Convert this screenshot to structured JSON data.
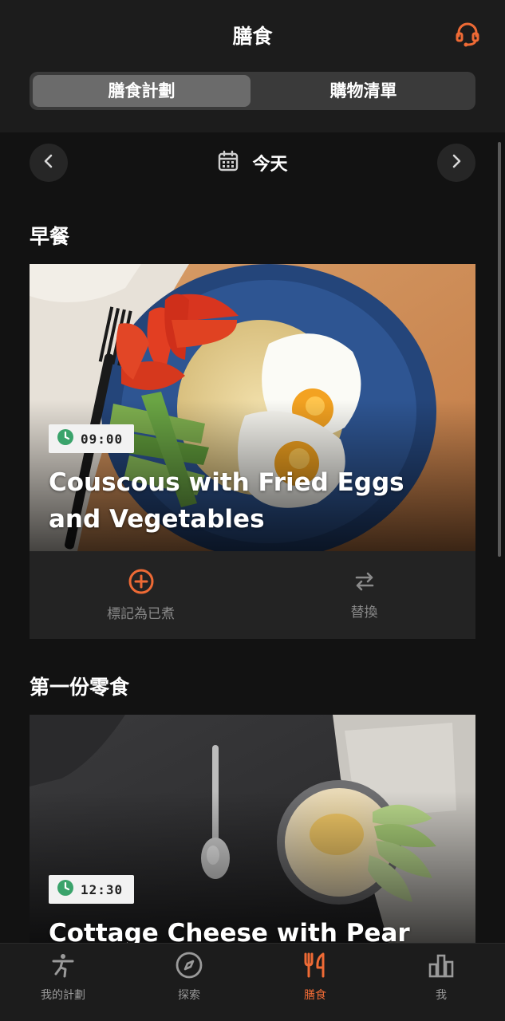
{
  "header": {
    "title": "膳食",
    "tabs": [
      {
        "label": "膳食計劃",
        "active": true
      },
      {
        "label": "購物清單",
        "active": false
      }
    ]
  },
  "date_nav": {
    "label": "今天"
  },
  "meals": [
    {
      "section": "早餐",
      "time": "09:00",
      "name": "Couscous with Fried Eggs and Vegetables",
      "actions": {
        "mark_cooked": "標記為已煮",
        "replace": "替換"
      }
    },
    {
      "section": "第一份零食",
      "time": "12:30",
      "name": "Cottage Cheese with Pear and"
    }
  ],
  "tabbar": [
    {
      "label": "我的計劃",
      "icon": "exercise-person-icon",
      "active": false
    },
    {
      "label": "探索",
      "icon": "compass-icon",
      "active": false
    },
    {
      "label": "膳食",
      "icon": "fork-knife-icon",
      "active": true
    },
    {
      "label": "我",
      "icon": "bar-chart-icon",
      "active": false
    }
  ],
  "colors": {
    "accent": "#ee6a35",
    "background": "#121212",
    "surface": "#1c1c1c",
    "clock_green": "#3aa36b"
  }
}
